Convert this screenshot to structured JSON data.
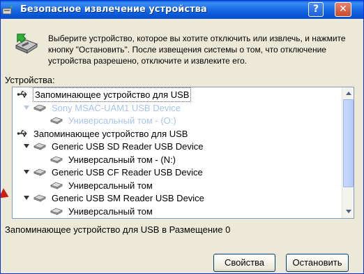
{
  "window": {
    "title": "Безопасное извлечение устройства",
    "help_label": "?",
    "close_label": "✕"
  },
  "description": "Выберите устройство, которое вы хотите отключить или извлечь, и нажмите кнопку \"Остановить\". После извещения системы о том, что отключение устройства разрешено, отключите и извлеките его.",
  "devices_label": "Устройства:",
  "tree": {
    "items": [
      {
        "label": "Запоминающее устройство для USB",
        "icon": "usb-icon",
        "level": 0,
        "expander": false,
        "state": "selected"
      },
      {
        "label": "Sony MSAC-UAM1 USB Device",
        "icon": "drive-icon",
        "level": 1,
        "expander": true,
        "state": "faded"
      },
      {
        "label": "Универсальный том - (O:)",
        "icon": "volume-icon",
        "level": 2,
        "expander": false,
        "state": "faded"
      },
      {
        "label": "Запоминающее устройство для USB",
        "icon": "usb-icon",
        "level": 0,
        "expander": false,
        "state": "normal"
      },
      {
        "label": "Generic USB SD Reader USB Device",
        "icon": "drive-icon",
        "level": 1,
        "expander": true,
        "state": "normal"
      },
      {
        "label": "Универсальный том - (N:)",
        "icon": "volume-icon",
        "level": 2,
        "expander": false,
        "state": "normal"
      },
      {
        "label": "Generic USB CF Reader USB Device",
        "icon": "drive-icon",
        "level": 1,
        "expander": true,
        "state": "normal"
      },
      {
        "label": "Универсальный том",
        "icon": "volume-icon",
        "level": 2,
        "expander": false,
        "state": "normal"
      },
      {
        "label": "Generic USB SM Reader USB Device",
        "icon": "drive-icon",
        "level": 1,
        "expander": true,
        "state": "normal"
      },
      {
        "label": "Универсальный том",
        "icon": "volume-icon",
        "level": 2,
        "expander": false,
        "state": "normal"
      }
    ]
  },
  "status_text": "Запоминающее устройство для USB в Размещение 0",
  "buttons": {
    "properties": "Свойства",
    "stop": "Остановить"
  },
  "colors": {
    "title_bar": "#0a5fd8",
    "dialog_bg": "#ece9d8",
    "faded_text": "#aac3ea",
    "annotation_marker": "#cc1d10"
  }
}
